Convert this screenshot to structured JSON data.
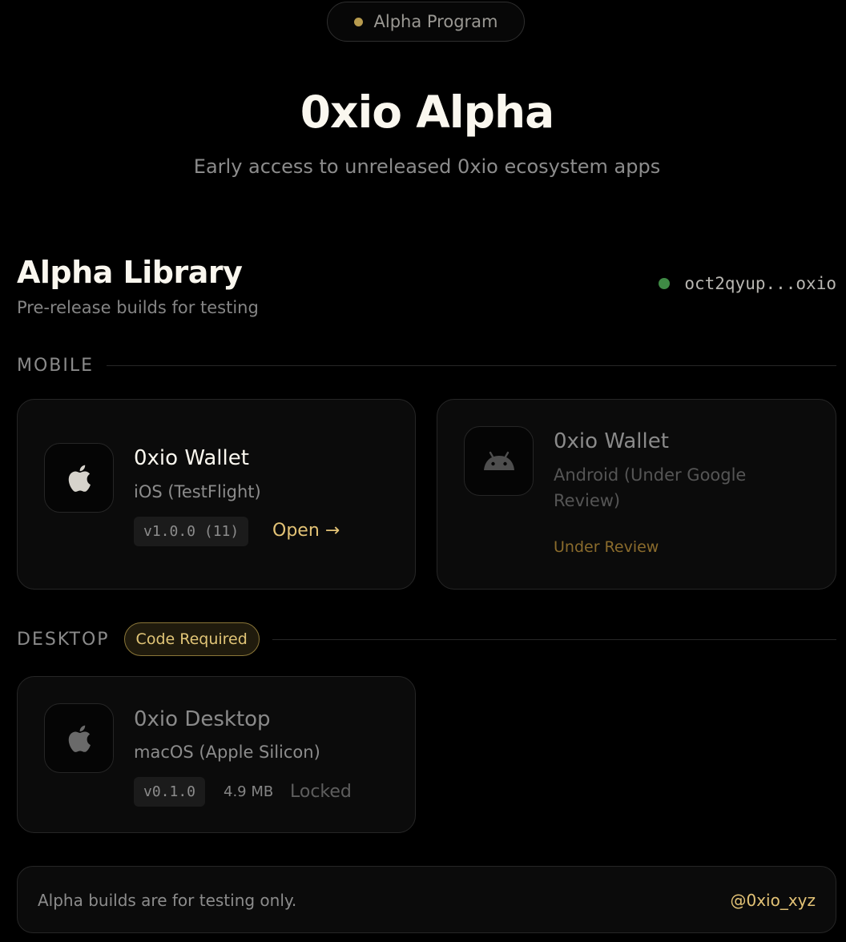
{
  "header": {
    "pill_label": "Alpha Program",
    "title": "0xio Alpha",
    "subtitle": "Early access to unreleased 0xio ecosystem apps"
  },
  "library": {
    "title": "Alpha Library",
    "subtitle": "Pre-release builds for testing",
    "wallet_address": "oct2qyup...oxio"
  },
  "mobile": {
    "section_label": "MOBILE",
    "apps": [
      {
        "name": "0xio Wallet",
        "platform": "iOS (TestFlight)",
        "version": "v1.0.0 (11)",
        "action": "Open →",
        "icon": "apple-icon"
      },
      {
        "name": "0xio Wallet",
        "platform": "Android (Under Google Review)",
        "status": "Under Review",
        "icon": "android-icon"
      }
    ]
  },
  "desktop": {
    "section_label": "DESKTOP",
    "badge": "Code Required",
    "apps": [
      {
        "name": "0xio Desktop",
        "platform": "macOS (Apple Silicon)",
        "version": "v0.1.0",
        "size": "4.9 MB",
        "status": "Locked",
        "icon": "apple-icon"
      }
    ]
  },
  "footer": {
    "note": "Alpha builds are for testing only.",
    "handle": "@0xio_xyz"
  },
  "colors": {
    "accent_gold": "#e3c376",
    "status_green": "#3f8a45",
    "background": "#000000"
  }
}
